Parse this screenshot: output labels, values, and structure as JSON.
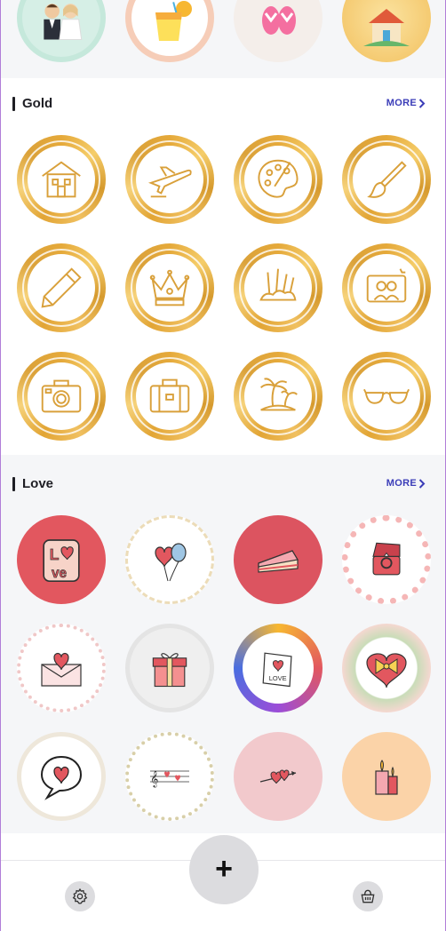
{
  "sections": {
    "gold": {
      "title": "Gold",
      "more_label": "MORE"
    },
    "love": {
      "title": "Love",
      "more_label": "MORE"
    }
  },
  "top_row_icons": [
    "wedding-couple-icon",
    "cocktail-drink-icon",
    "flip-flops-icon",
    "house-icon"
  ],
  "gold_icons": [
    "house-icon",
    "airplane-icon",
    "paint-palette-icon",
    "paintbrush-icon",
    "pencil-icon",
    "crown-icon",
    "art-supplies-icon",
    "photo-frame-icon",
    "camera-icon",
    "suitcase-icon",
    "palm-island-icon",
    "sunglasses-icon"
  ],
  "love_icons": [
    "love-text-icon",
    "heart-balloon-icon",
    "cake-slice-icon",
    "ring-box-icon",
    "love-letter-icon",
    "gift-box-icon",
    "love-card-icon",
    "heart-bow-icon",
    "heart-speech-bubble-icon",
    "music-hearts-icon",
    "arrow-hearts-icon",
    "candle-hearts-icon"
  ],
  "love_card_text": "LOVE",
  "love_sticker_text": "Love",
  "bottom_nav": {
    "fab_label": "+",
    "settings_icon": "gear-icon",
    "shop_icon": "basket-icon"
  },
  "colors": {
    "gold": "#e5a93a",
    "accent_more": "#3b3db8",
    "love_red": "#e0505a",
    "love_pink": "#f2c9cc",
    "love_peach": "#fbd3a8"
  }
}
